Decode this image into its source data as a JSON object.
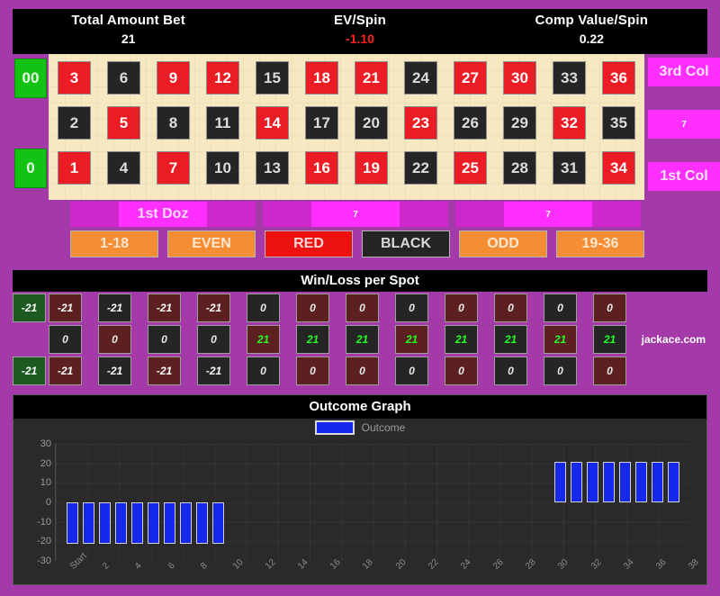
{
  "stats": {
    "items": [
      {
        "label": "Total Amount Bet",
        "value": "21",
        "negative": false
      },
      {
        "label": "EV/Spin",
        "value": "-1.10",
        "negative": true
      },
      {
        "label": "Comp Value/Spin",
        "value": "0.22",
        "negative": false
      }
    ]
  },
  "board": {
    "zeros": [
      {
        "label": "00",
        "name": "double-zero"
      },
      {
        "label": "0",
        "name": "single-zero"
      }
    ],
    "rows": [
      {
        "numbers": [
          "3",
          "6",
          "9",
          "12",
          "15",
          "18",
          "21",
          "24",
          "27",
          "30",
          "33",
          "36"
        ],
        "colors": [
          "red",
          "black",
          "red",
          "red",
          "black",
          "red",
          "red",
          "black",
          "red",
          "red",
          "black",
          "red"
        ]
      },
      {
        "numbers": [
          "2",
          "5",
          "8",
          "11",
          "14",
          "17",
          "20",
          "23",
          "26",
          "29",
          "32",
          "35"
        ],
        "colors": [
          "black",
          "red",
          "black",
          "black",
          "red",
          "black",
          "black",
          "red",
          "black",
          "black",
          "red",
          "black"
        ]
      },
      {
        "numbers": [
          "1",
          "4",
          "7",
          "10",
          "13",
          "16",
          "19",
          "22",
          "25",
          "28",
          "31",
          "34"
        ],
        "colors": [
          "red",
          "black",
          "red",
          "black",
          "black",
          "red",
          "red",
          "black",
          "red",
          "black",
          "black",
          "red"
        ]
      }
    ],
    "column_labels": [
      {
        "text": "3rd Col",
        "is_bet": false
      },
      {
        "text": "7",
        "is_bet": true
      },
      {
        "text": "1st Col",
        "is_bet": false
      }
    ]
  },
  "dozens": [
    {
      "text": "1st Doz",
      "is_bet": false
    },
    {
      "text": "7",
      "is_bet": true
    },
    {
      "text": "7",
      "is_bet": true
    }
  ],
  "outside_bets": [
    {
      "label": "1-18",
      "style": "orange"
    },
    {
      "label": "EVEN",
      "style": "orange"
    },
    {
      "label": "RED",
      "style": "red"
    },
    {
      "label": "BLACK",
      "style": "black"
    },
    {
      "label": "ODD",
      "style": "orange"
    },
    {
      "label": "19-36",
      "style": "orange"
    }
  ],
  "winloss": {
    "title": "Win/Loss per Spot",
    "watermark": "jackace.com",
    "zeros": [
      {
        "value": "-21",
        "state": "loss"
      },
      {
        "value": "-21",
        "state": "loss"
      }
    ],
    "rows": [
      {
        "values": [
          "-21",
          "-21",
          "-21",
          "-21",
          "0",
          "0",
          "0",
          "0",
          "0",
          "0",
          "0",
          "0"
        ],
        "states": [
          "loss",
          "loss",
          "loss",
          "loss",
          "zero",
          "zero",
          "zero",
          "zero",
          "zero",
          "zero",
          "zero",
          "zero"
        ],
        "colors": [
          "red",
          "black",
          "red",
          "red",
          "black",
          "red",
          "red",
          "black",
          "red",
          "red",
          "black",
          "red"
        ]
      },
      {
        "values": [
          "0",
          "0",
          "0",
          "0",
          "21",
          "21",
          "21",
          "21",
          "21",
          "21",
          "21",
          "21"
        ],
        "states": [
          "zero",
          "zero",
          "zero",
          "zero",
          "win",
          "win",
          "win",
          "win",
          "win",
          "win",
          "win",
          "win"
        ],
        "colors": [
          "black",
          "red",
          "black",
          "black",
          "red",
          "black",
          "black",
          "red",
          "black",
          "black",
          "red",
          "black"
        ]
      },
      {
        "values": [
          "-21",
          "-21",
          "-21",
          "-21",
          "0",
          "0",
          "0",
          "0",
          "0",
          "0",
          "0",
          "0"
        ],
        "states": [
          "loss",
          "loss",
          "loss",
          "loss",
          "zero",
          "zero",
          "zero",
          "zero",
          "zero",
          "zero",
          "zero",
          "zero"
        ],
        "colors": [
          "red",
          "black",
          "red",
          "black",
          "black",
          "red",
          "red",
          "black",
          "red",
          "black",
          "black",
          "red"
        ]
      }
    ]
  },
  "chart_data": {
    "type": "bar",
    "title": "Outcome Graph",
    "xlabel": "",
    "ylabel": "",
    "ylim": [
      -30,
      30
    ],
    "yticks": [
      30,
      20,
      10,
      0,
      -10,
      -20,
      -30
    ],
    "xticks": [
      "Start",
      "2",
      "4",
      "6",
      "8",
      "10",
      "12",
      "14",
      "16",
      "18",
      "20",
      "22",
      "24",
      "26",
      "28",
      "30",
      "32",
      "34",
      "36",
      "38"
    ],
    "grid": true,
    "legend": {
      "position": "top-center",
      "entries": [
        "Outcome"
      ],
      "color": "#1528ec"
    },
    "series": [
      {
        "name": "Outcome",
        "color": "#1528ec",
        "values": [
          -21,
          -21,
          -21,
          -21,
          -21,
          -21,
          -21,
          -21,
          -21,
          -21,
          0,
          0,
          0,
          0,
          0,
          0,
          0,
          0,
          0,
          0,
          0,
          0,
          0,
          0,
          0,
          0,
          0,
          0,
          0,
          0,
          21,
          21,
          21,
          21,
          21,
          21,
          21,
          21
        ]
      }
    ]
  }
}
